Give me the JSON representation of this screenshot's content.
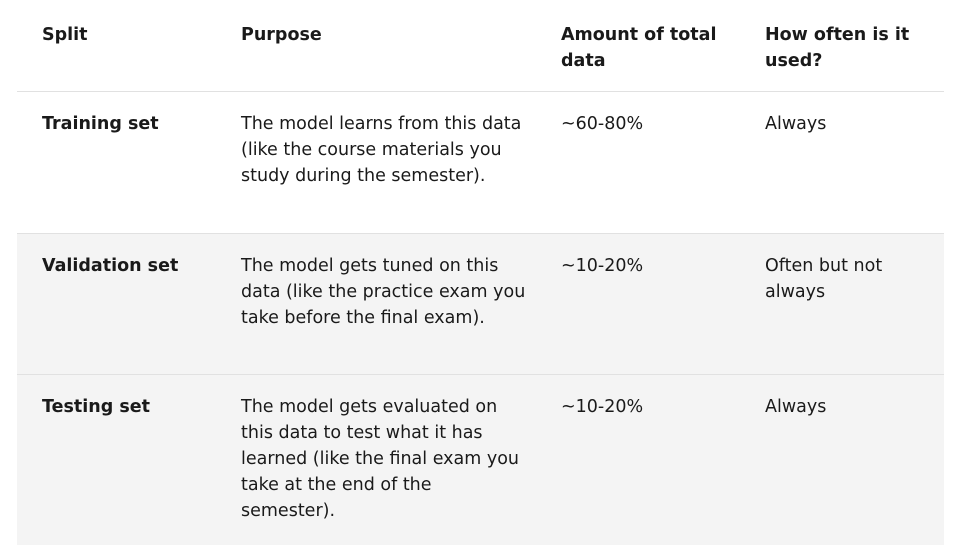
{
  "table": {
    "headers": [
      "Split",
      "Purpose",
      "Amount of total data",
      "How often is it used?"
    ],
    "rows": [
      {
        "split": "Training set",
        "purpose": "The model learns from this data (like the course materials you study during the semester).",
        "amount": "~60-80%",
        "frequency": "Always"
      },
      {
        "split": "Validation set",
        "purpose": "The model gets tuned on this data (like the practice exam you take before the final exam).",
        "amount": "~10-20%",
        "frequency": "Often but not always"
      },
      {
        "split": "Testing set",
        "purpose": "The model gets evaluated on this data to test what it has learned (like the final exam you take at the end of the semester).",
        "amount": "~10-20%",
        "frequency": "Always"
      }
    ],
    "colors": {
      "header_bg": "#ffffff",
      "row_bg_odd": "#ffffff",
      "row_bg_even": "#f4f4f4",
      "border": "#e1e1e1",
      "text": "#1a1a1a"
    }
  }
}
